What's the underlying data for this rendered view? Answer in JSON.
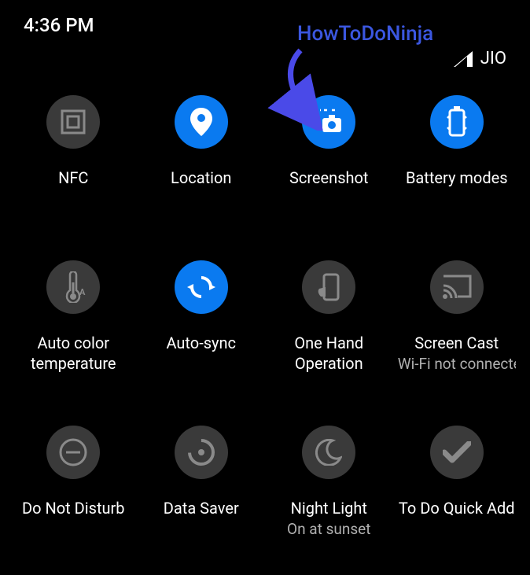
{
  "status": {
    "time": "4:36 PM",
    "carrier": "JIO"
  },
  "annotation": {
    "text": "HowToDoNinja"
  },
  "tiles": [
    {
      "label": "NFC",
      "sublabel": "",
      "active": false,
      "icon": "nfc"
    },
    {
      "label": "Location",
      "sublabel": "",
      "active": true,
      "icon": "location"
    },
    {
      "label": "Screenshot",
      "sublabel": "",
      "active": true,
      "icon": "screenshot"
    },
    {
      "label": "Battery modes",
      "sublabel": "",
      "active": true,
      "icon": "battery"
    },
    {
      "label": "Auto color temperature",
      "sublabel": "",
      "active": false,
      "icon": "thermometer"
    },
    {
      "label": "Auto-sync",
      "sublabel": "",
      "active": true,
      "icon": "sync"
    },
    {
      "label": "One Hand Operation",
      "sublabel": "",
      "active": false,
      "icon": "onehand"
    },
    {
      "label": "Screen Cast",
      "sublabel": "Wi-Fi not connected",
      "active": false,
      "icon": "cast"
    },
    {
      "label": "Do Not Disturb",
      "sublabel": "",
      "active": false,
      "icon": "dnd"
    },
    {
      "label": "Data Saver",
      "sublabel": "",
      "active": false,
      "icon": "datasaver"
    },
    {
      "label": "Night Light",
      "sublabel": "On at sunset",
      "active": false,
      "icon": "moon"
    },
    {
      "label": "To Do Quick Add",
      "sublabel": "",
      "active": false,
      "icon": "check"
    }
  ]
}
